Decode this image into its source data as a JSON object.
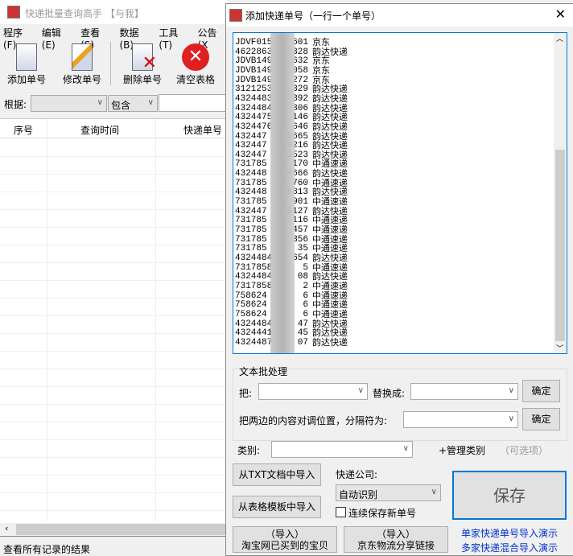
{
  "main": {
    "title": "快递批量查询高手 【与我】",
    "menu": [
      "程序(F)",
      "编辑(E)",
      "查看(S)",
      "数据(B)",
      "工具(T)",
      "公告(X"
    ],
    "toolbar": [
      "添加单号",
      "修改单号",
      "删除单号",
      "清空表格"
    ],
    "filter": {
      "label": "根据:",
      "field": "",
      "op": "包含",
      "value": ""
    },
    "columns": [
      "序号",
      "查询时间",
      "快递单号"
    ],
    "status": "查看所有记录的结果"
  },
  "dialog": {
    "title": "添加快递单号（一行一个单号）",
    "lines": [
      {
        "p": "JDVF015",
        "s": "601",
        "c": "京东"
      },
      {
        "p": "4622863",
        "s": "328",
        "c": "韵达快递"
      },
      {
        "p": "JDVB149",
        "s": "632",
        "c": "京东"
      },
      {
        "p": "JDVB149",
        "s": "058",
        "c": "京东"
      },
      {
        "p": "JDVB149",
        "s": "272",
        "c": "京东"
      },
      {
        "p": "3121253",
        "s": "329",
        "c": "韵达快递"
      },
      {
        "p": "4324483",
        "s": "392",
        "c": "韵达快递"
      },
      {
        "p": "4324484",
        "s": "306",
        "c": "韵达快递"
      },
      {
        "p": "4324475",
        "s": "146",
        "c": "韵达快递"
      },
      {
        "p": "4324476",
        "s": "646",
        "c": "韵达快递"
      },
      {
        "p": "432447",
        "s": "0665",
        "c": "韵达快递"
      },
      {
        "p": "432447",
        "s": "9216",
        "c": "韵达快递"
      },
      {
        "p": "432447",
        "s": "3523",
        "c": "韵达快递"
      },
      {
        "p": "731785",
        "s": "170",
        "c": "中通速递"
      },
      {
        "p": "432448",
        "s": "4666",
        "c": "韵达快递"
      },
      {
        "p": "731785",
        "s": "760",
        "c": "中通速递"
      },
      {
        "p": "432448",
        "s": "8813",
        "c": "韵达快递"
      },
      {
        "p": "731785",
        "s": "901",
        "c": "中通速递"
      },
      {
        "p": "432447",
        "s": "9127",
        "c": "韵达快递"
      },
      {
        "p": "731785",
        "s": "116",
        "c": "中通速递"
      },
      {
        "p": "731785",
        "s": "457",
        "c": "中通速递"
      },
      {
        "p": "731785",
        "s": "356",
        "c": "中通速递"
      },
      {
        "p": "731785",
        "s": "35",
        "c": "中通速递"
      },
      {
        "p": "4324484",
        "s": "654",
        "c": "韵达快递"
      },
      {
        "p": "7317858",
        "s": "5",
        "c": "中通速递"
      },
      {
        "p": "4324484",
        "s": "08",
        "c": "韵达快递"
      },
      {
        "p": "7317858",
        "s": "2",
        "c": "中通速递"
      },
      {
        "p": "758624",
        "s": "6",
        "c": "中通速递"
      },
      {
        "p": "758624",
        "s": "6",
        "c": "中通速递"
      },
      {
        "p": "758624",
        "s": "6",
        "c": "中通速递"
      },
      {
        "p": "4324484",
        "s": "47",
        "c": "韵达快递"
      },
      {
        "p": "4324441",
        "s": "45",
        "c": "韵达快递"
      },
      {
        "p": "4324487",
        "s": "07",
        "c": "韵达快递"
      }
    ],
    "batch": {
      "group": "文本批处理",
      "from_label": "把:",
      "to_label": "替换成:",
      "ok": "确定",
      "swap_label": "把两边的内容对调位置，分隔符为:",
      "ok2": "确定"
    },
    "category_label": "类别:",
    "manage_category": "+管理类别",
    "optional": "（可选项）",
    "import_txt": "从TXT文档中导入",
    "import_table": "从表格模板中导入",
    "company_label": "快递公司:",
    "company_value": "自动识别",
    "continuous": "连续保存新单号",
    "save": "保存",
    "import_taobao": [
      "（导入）",
      "淘宝网已买到的宝贝"
    ],
    "import_jd": [
      "（导入）",
      "京东物流分享链接"
    ],
    "demo_single": "单家快递单号导入演示",
    "demo_multi": "多家快递混合导入演示"
  }
}
